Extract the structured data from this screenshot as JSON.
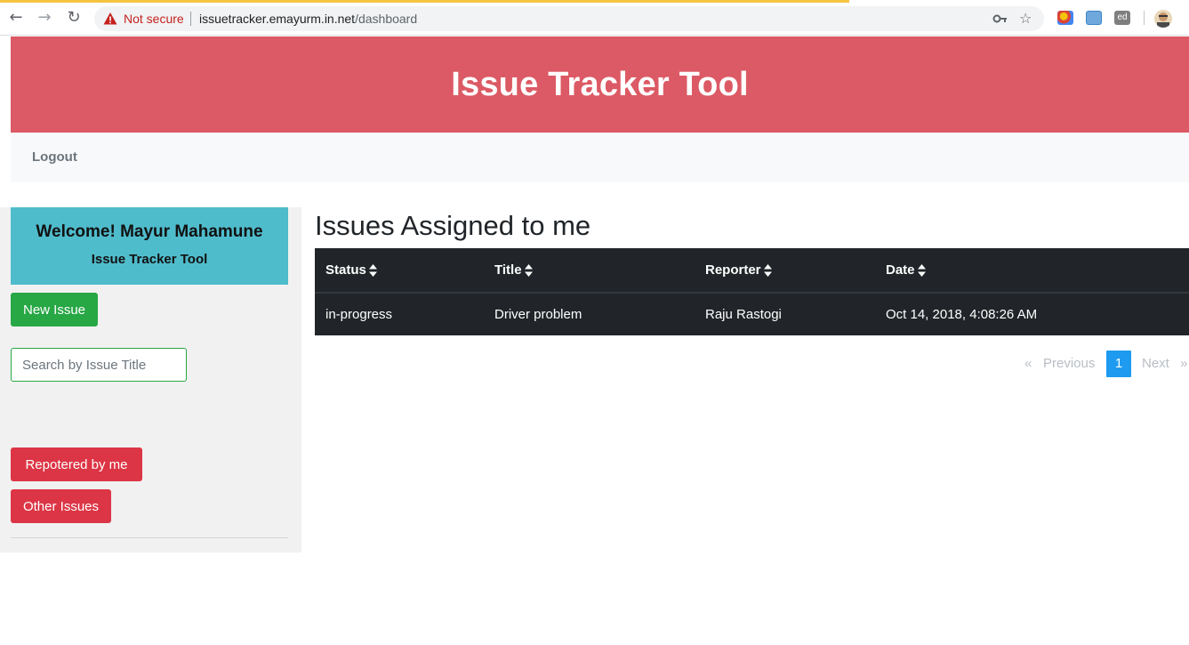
{
  "browser": {
    "security_label": "Not secure",
    "url_host": "issuetracker.emayurm.in.net",
    "url_path": "/dashboard"
  },
  "header": {
    "title": "Issue Tracker Tool",
    "background": "#dc5a65"
  },
  "navbar": {
    "logout_label": "Logout"
  },
  "sidebar": {
    "welcome_text": "Welcome! Mayur Mahamune",
    "welcome_subtitle": "Issue Tracker Tool",
    "new_issue_label": "New Issue",
    "search_placeholder": "Search by Issue Title",
    "search_value": "",
    "reported_by_me_label": "Repotered by me",
    "other_issues_label": "Other Issues"
  },
  "main": {
    "heading": "Issues Assigned to me",
    "columns": [
      "Status",
      "Title",
      "Reporter",
      "Date"
    ],
    "rows": [
      {
        "status": "in-progress",
        "title": "Driver problem",
        "reporter": "Raju Rastogi",
        "date": "Oct 14, 2018, 4:08:26 AM"
      }
    ]
  },
  "pagination": {
    "first_symbol": "«",
    "previous_label": "Previous",
    "current_page": "1",
    "next_label": "Next",
    "last_symbol": "»"
  },
  "colors": {
    "accent_green": "#28a745",
    "accent_red": "#dc3545",
    "welcome_bg": "#4fbccc",
    "table_bg": "#212529",
    "active_page": "#1e9bf0"
  }
}
